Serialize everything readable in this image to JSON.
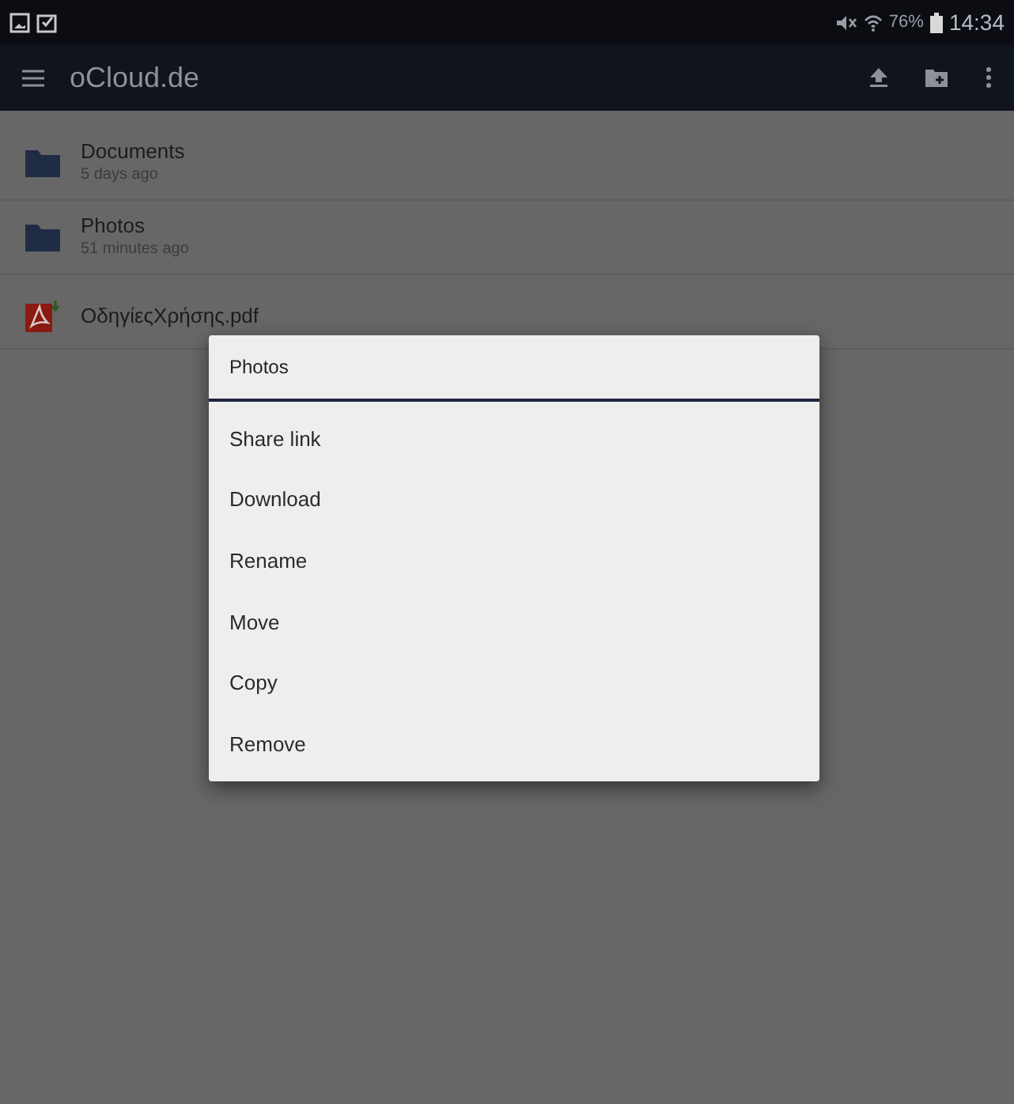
{
  "status_bar": {
    "battery": "76%",
    "time": "14:34"
  },
  "toolbar": {
    "title": "oCloud.de"
  },
  "files": [
    {
      "kind": "folder",
      "name": "Documents",
      "modified": "5 days ago"
    },
    {
      "kind": "folder",
      "name": "Photos",
      "modified": "51 minutes ago"
    },
    {
      "kind": "pdf",
      "name": "ΟδηγίεςΧρήσης.pdf"
    }
  ],
  "dialog": {
    "title": "Photos",
    "items": [
      "Share link",
      "Download",
      "Rename",
      "Move",
      "Copy",
      "Remove"
    ]
  }
}
